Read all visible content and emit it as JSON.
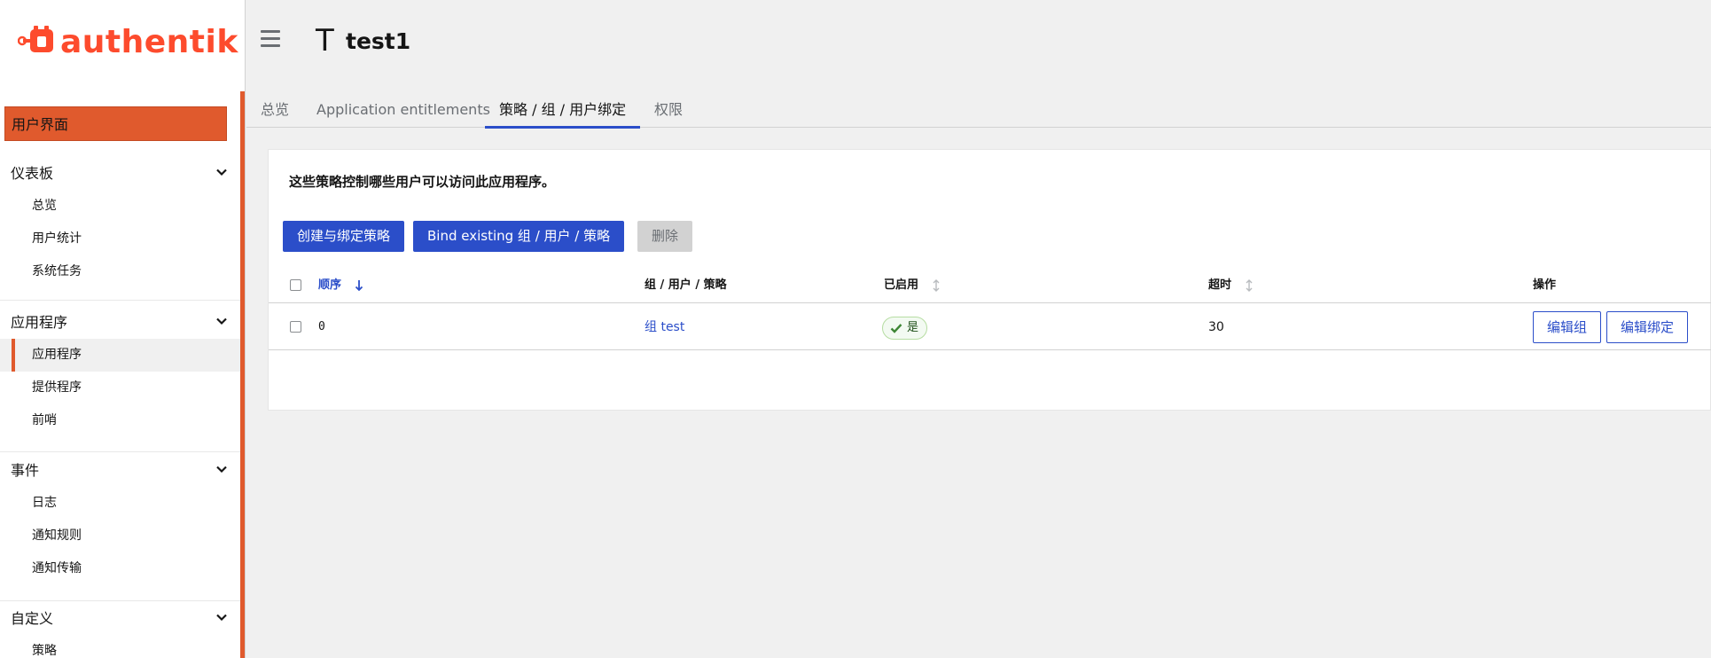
{
  "brand": {
    "name": "authentik",
    "color": "#fd4b2d"
  },
  "sidebar": {
    "user_interface": "用户界面",
    "sections": [
      {
        "label": "仪表板",
        "items": [
          "总览",
          "用户统计",
          "系统任务"
        ]
      },
      {
        "label": "应用程序",
        "items": [
          "应用程序",
          "提供程序",
          "前哨"
        ],
        "active_item": "应用程序"
      },
      {
        "label": "事件",
        "items": [
          "日志",
          "通知规则",
          "通知传输"
        ]
      },
      {
        "label": "自定义",
        "items": [
          "策略"
        ]
      }
    ]
  },
  "header": {
    "title_icon": "T",
    "title": "test1"
  },
  "tabs": [
    {
      "label": "总览"
    },
    {
      "label": "Application entitlements"
    },
    {
      "label": "策略 / 组 / 用户绑定",
      "active": true
    },
    {
      "label": "权限"
    }
  ],
  "card": {
    "description": "这些策略控制哪些用户可以访问此应用程序。",
    "buttons": {
      "create": "创建与绑定策略",
      "bind": "Bind existing 组 / 用户 / 策略",
      "delete": "删除"
    },
    "table": {
      "columns": [
        "顺序",
        "组 / 用户 / 策略",
        "已启用",
        "超时",
        "操作"
      ],
      "rows": [
        {
          "order": "0",
          "target": "组 test",
          "enabled": "是",
          "timeout": "30",
          "actions": [
            "编辑组",
            "编辑绑定"
          ]
        }
      ]
    }
  },
  "colors": {
    "accent": "#e05a2d",
    "primary": "#2b4ec9"
  }
}
